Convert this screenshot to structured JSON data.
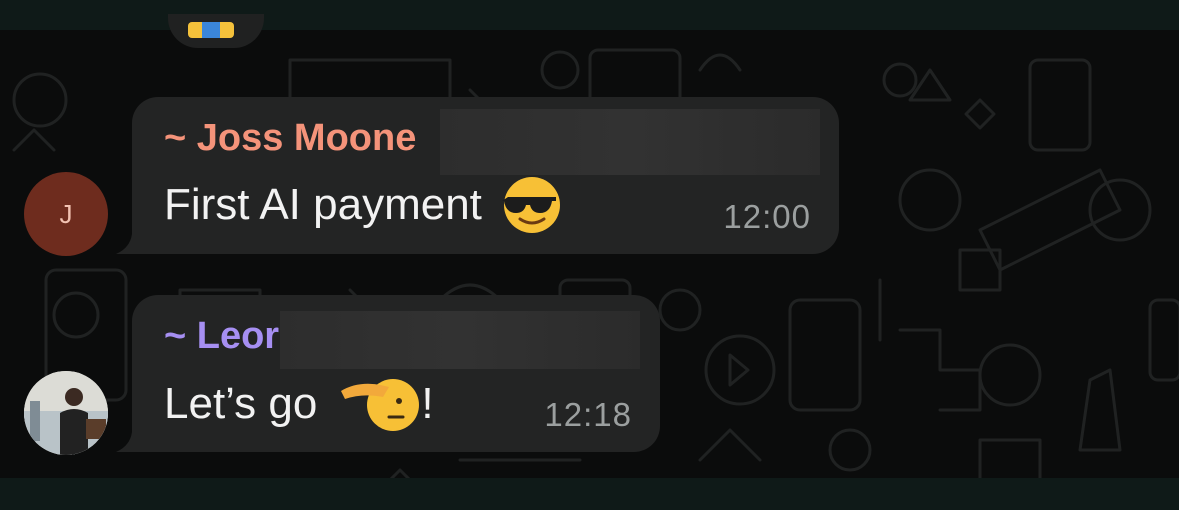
{
  "chat": {
    "messages": [
      {
        "sender": "~ Joss Moone",
        "sender_color": "#f4937a",
        "avatar_initial": "J",
        "avatar_color": "#6e2c1e",
        "text": "First AI payment",
        "emoji": "smiling-face-with-sunglasses",
        "time": "12:00"
      },
      {
        "sender": "~ Leor",
        "sender_color": "#a68ff2",
        "avatar": "profile-photo",
        "text": "Let’s go",
        "emoji": "saluting-face",
        "suffix": "!",
        "time": "12:18"
      }
    ]
  },
  "colors": {
    "background": "#0b0c0c",
    "bubble": "#232424",
    "bar": "#0f1a18",
    "timestamp": "#9b9f9f"
  }
}
